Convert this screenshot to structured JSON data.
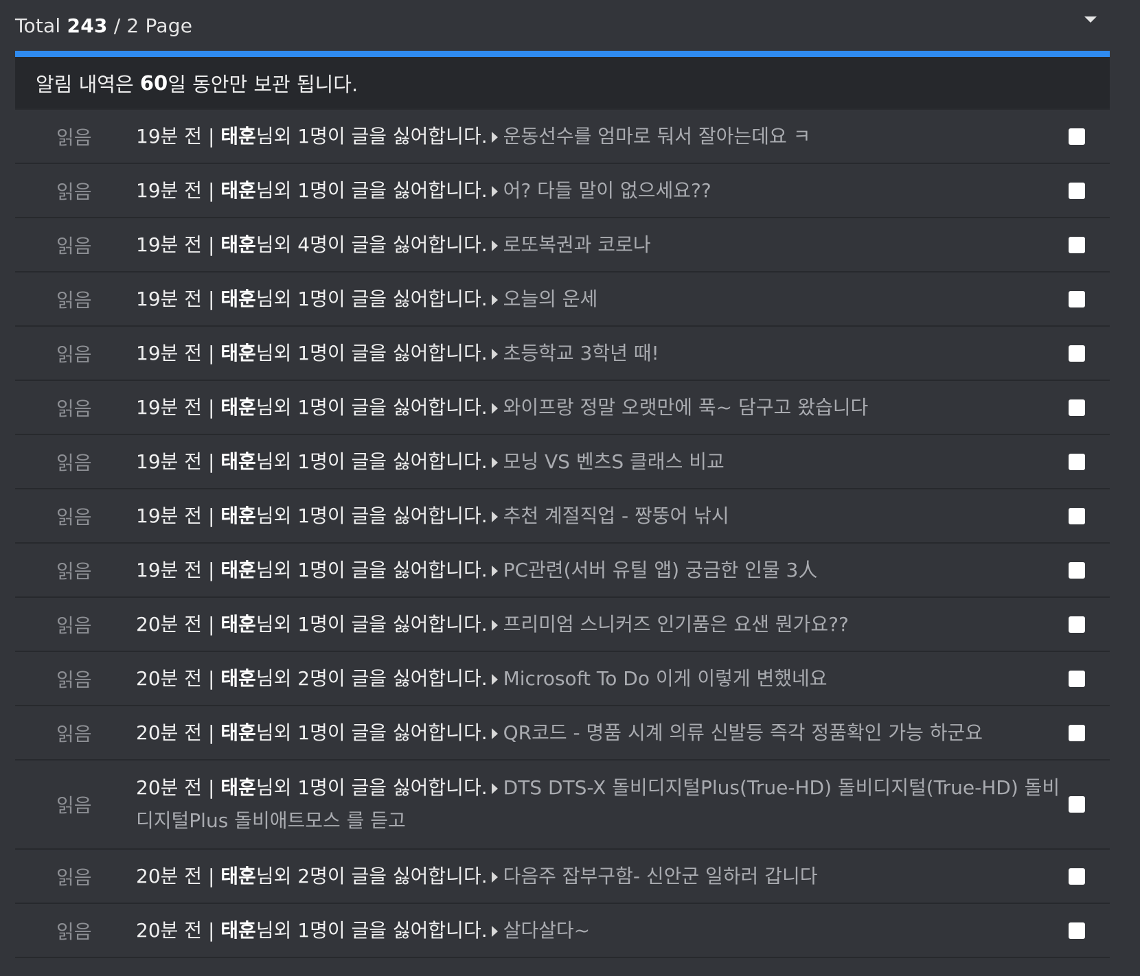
{
  "header": {
    "total_prefix": "Total",
    "total_count": "243",
    "total_suffix": "/ 2 Page"
  },
  "notice": {
    "before": "알림 내역은",
    "days": "60",
    "after": "일 동안만 보관 됩니다."
  },
  "colors": {
    "accent": "#2f8bf0",
    "background": "#33353a",
    "notice_bg": "#26282c"
  },
  "icons": {
    "dropdown": "chevron-down-icon",
    "arrow": "triangle-right-icon",
    "checkbox": "checkbox-icon"
  },
  "rows": [
    {
      "status": "읽음",
      "time": "19분 전 |",
      "name": "태훈",
      "msg": "님외 1명이 글을 싫어합니다.",
      "title": "운동선수를 엄마로 둬서 잘아는데요 ㅋ"
    },
    {
      "status": "읽음",
      "time": "19분 전 |",
      "name": "태훈",
      "msg": "님외 1명이 글을 싫어합니다.",
      "title": "어? 다들 말이 없으세요??"
    },
    {
      "status": "읽음",
      "time": "19분 전 |",
      "name": "태훈",
      "msg": "님외 4명이 글을 싫어합니다.",
      "title": "로또복권과 코로나"
    },
    {
      "status": "읽음",
      "time": "19분 전 |",
      "name": "태훈",
      "msg": "님외 1명이 글을 싫어합니다.",
      "title": "오늘의 운세"
    },
    {
      "status": "읽음",
      "time": "19분 전 |",
      "name": "태훈",
      "msg": "님외 1명이 글을 싫어합니다.",
      "title": "초등학교 3학년 때!"
    },
    {
      "status": "읽음",
      "time": "19분 전 |",
      "name": "태훈",
      "msg": "님외 1명이 글을 싫어합니다.",
      "title": "와이프랑 정말 오랫만에 푹~ 담구고 왔습니다"
    },
    {
      "status": "읽음",
      "time": "19분 전 |",
      "name": "태훈",
      "msg": "님외 1명이 글을 싫어합니다.",
      "title": "모닝 VS 벤츠S 클래스 비교"
    },
    {
      "status": "읽음",
      "time": "19분 전 |",
      "name": "태훈",
      "msg": "님외 1명이 글을 싫어합니다.",
      "title": "추천 계절직업 - 짱뚱어 낚시"
    },
    {
      "status": "읽음",
      "time": "19분 전 |",
      "name": "태훈",
      "msg": "님외 1명이 글을 싫어합니다.",
      "title": "PC관련(서버 유틸 앱) 궁금한 인물 3人"
    },
    {
      "status": "읽음",
      "time": "20분 전 |",
      "name": "태훈",
      "msg": "님외 1명이 글을 싫어합니다.",
      "title": "프리미엄 스니커즈 인기품은 요샌 뭔가요??"
    },
    {
      "status": "읽음",
      "time": "20분 전 |",
      "name": "태훈",
      "msg": "님외 2명이 글을 싫어합니다.",
      "title": "Microsoft To Do 이게 이렇게 변했네요"
    },
    {
      "status": "읽음",
      "time": "20분 전 |",
      "name": "태훈",
      "msg": "님외 1명이 글을 싫어합니다.",
      "title": "QR코드 - 명품 시계 의류 신발등 즉각 정품확인 가능 하군요"
    },
    {
      "status": "읽음",
      "time": "20분 전 |",
      "name": "태훈",
      "msg": "님외 1명이 글을 싫어합니다.",
      "title": "DTS DTS-X 돌비디지털Plus(True-HD) 돌비디지털(True-HD) 돌비디지털Plus 돌비애트모스 를 듣고"
    },
    {
      "status": "읽음",
      "time": "20분 전 |",
      "name": "태훈",
      "msg": "님외 2명이 글을 싫어합니다.",
      "title": "다음주 잡부구함- 신안군 일하러 갑니다"
    },
    {
      "status": "읽음",
      "time": "20분 전 |",
      "name": "태훈",
      "msg": "님외 1명이 글을 싫어합니다.",
      "title": "살다살다~"
    }
  ]
}
